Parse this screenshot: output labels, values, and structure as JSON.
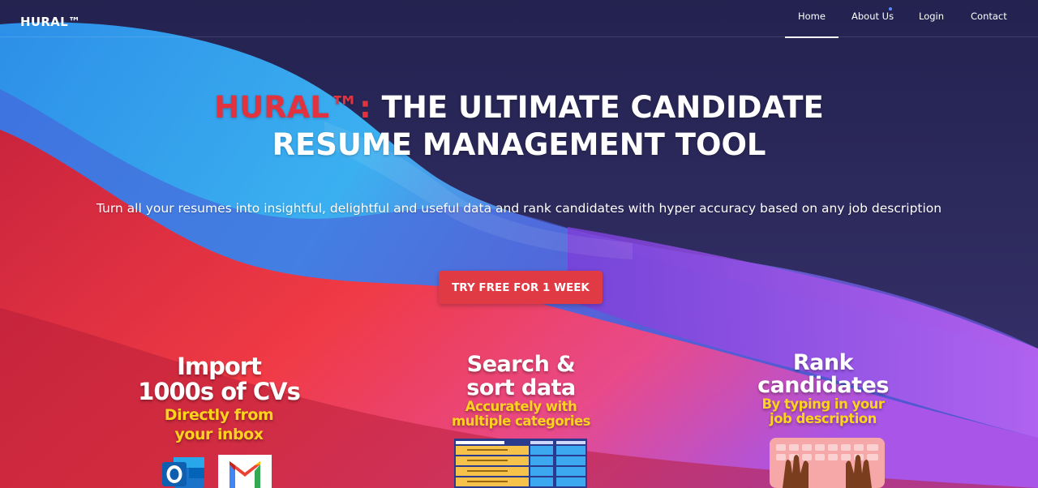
{
  "brand": {
    "logo": "HURAL™"
  },
  "nav": {
    "items": [
      {
        "label": "Home"
      },
      {
        "label": "About Us"
      },
      {
        "label": "Login"
      },
      {
        "label": "Contact"
      }
    ]
  },
  "hero": {
    "title_brand": "HURAL™:",
    "title_rest_1": " THE ULTIMATE CANDIDATE",
    "title_rest_2": "RESUME MANAGEMENT TOOL",
    "subtitle": "Turn all your resumes into insightful, delightful and useful data and rank candidates with hyper accuracy based on any job description",
    "cta_label": "TRY FREE FOR 1 WEEK"
  },
  "features": [
    {
      "heading_1": "Import",
      "heading_2": "1000s of CVs",
      "sub_1": "Directly from",
      "sub_2": "your inbox"
    },
    {
      "heading_1": "Search &",
      "heading_2": "sort data",
      "sub_1": "Accurately with",
      "sub_2": "multiple categories"
    },
    {
      "heading_1": "Rank",
      "heading_2": "candidates",
      "sub_1": "By typing in your",
      "sub_2": "job description"
    }
  ],
  "colors": {
    "accent_red": "#e0323f",
    "cta_bg": "#e03a44",
    "highlight_yellow": "#ffd21f",
    "nav_bg": "#2b2a55"
  },
  "icons": {
    "feature_1": [
      "outlook-icon",
      "gmail-icon"
    ],
    "feature_2": "data-table-image",
    "feature_3": "keyboard-hands-image"
  }
}
